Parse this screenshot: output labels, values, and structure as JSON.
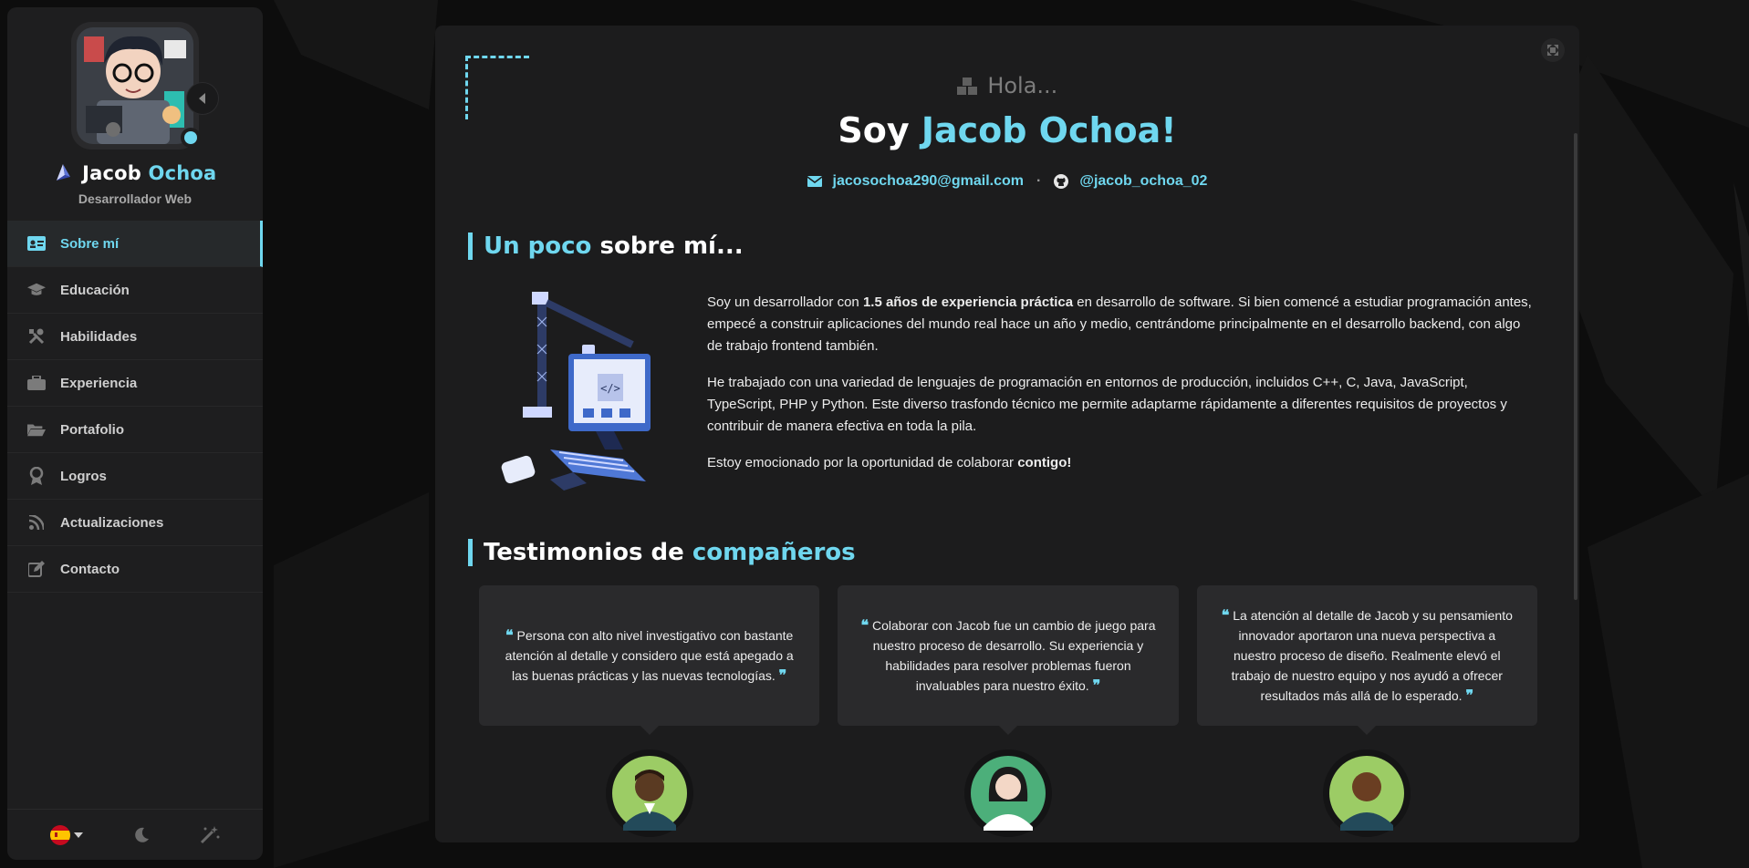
{
  "sidebar": {
    "profile": {
      "first_name": "Jacob",
      "last_name": "Ochoa",
      "role": "Desarrollador Web",
      "status": "online"
    },
    "nav": [
      {
        "label": "Sobre mí",
        "icon": "id-card-icon",
        "active": true
      },
      {
        "label": "Educación",
        "icon": "graduation-cap-icon",
        "active": false
      },
      {
        "label": "Habilidades",
        "icon": "tools-icon",
        "active": false
      },
      {
        "label": "Experiencia",
        "icon": "briefcase-icon",
        "active": false
      },
      {
        "label": "Portafolio",
        "icon": "folder-open-icon",
        "active": false
      },
      {
        "label": "Logros",
        "icon": "award-icon",
        "active": false
      },
      {
        "label": "Actualizaciones",
        "icon": "rss-icon",
        "active": false
      },
      {
        "label": "Contacto",
        "icon": "edit-icon",
        "active": false
      }
    ],
    "footer": {
      "language_icon": "spain-flag-icon",
      "theme_icon": "moon-icon",
      "effects_icon": "magic-wand-icon"
    }
  },
  "hero": {
    "greeting": "Hola...",
    "headline_prefix": "Soy",
    "headline_name": "Jacob Ochoa!",
    "email": "jacosochoa290@gmail.com",
    "separator": "·",
    "github": "@jacob_ochoa_02"
  },
  "about": {
    "title_accent": "Un poco",
    "title_rest": "sobre mí...",
    "p1_a": "Soy un desarrollador con ",
    "p1_bold": "1.5 años de experiencia práctica",
    "p1_b": " en desarrollo de software. Si bien comencé a estudiar programación antes, empecé a construir aplicaciones del mundo real hace un año y medio, centrándome principalmente en el desarrollo backend, con algo de trabajo frontend también.",
    "p2": "He trabajado con una variedad de lenguajes de programación en entornos de producción, incluidos C++, C, Java, JavaScript, TypeScript, PHP y Python. Este diverso trasfondo técnico me permite adaptarme rápidamente a diferentes requisitos de proyectos y contribuir de manera efectiva en toda la pila.",
    "p3_a": "Estoy emocionado por la oportunidad de colaborar ",
    "p3_bold": "contigo!"
  },
  "testimonials": {
    "title_plain": "Testimonios de",
    "title_accent": "compañeros",
    "open_quote": "❝",
    "close_quote": "❞",
    "items": [
      {
        "text": "Persona con alto nivel investigativo con bastante atención al detalle y considero que está apegado a las buenas prácticas y las nuevas tecnologías."
      },
      {
        "text": "Colaborar con Jacob fue un cambio de juego para nuestro proceso de desarrollo. Su experiencia y habilidades para resolver problemas fueron invaluables para nuestro éxito."
      },
      {
        "text": "La atención al detalle de Jacob y su pensamiento innovador aportaron una nueva perspectiva a nuestro proceso de diseño. Realmente elevó el trabajo de nuestro equipo y nos ayudó a ofrecer resultados más allá de lo esperado."
      }
    ]
  },
  "colors": {
    "accent": "#6fd7ef",
    "panel": "#1c1c1d",
    "sidebar": "#1e1e1f",
    "card": "#2a2a2c"
  }
}
